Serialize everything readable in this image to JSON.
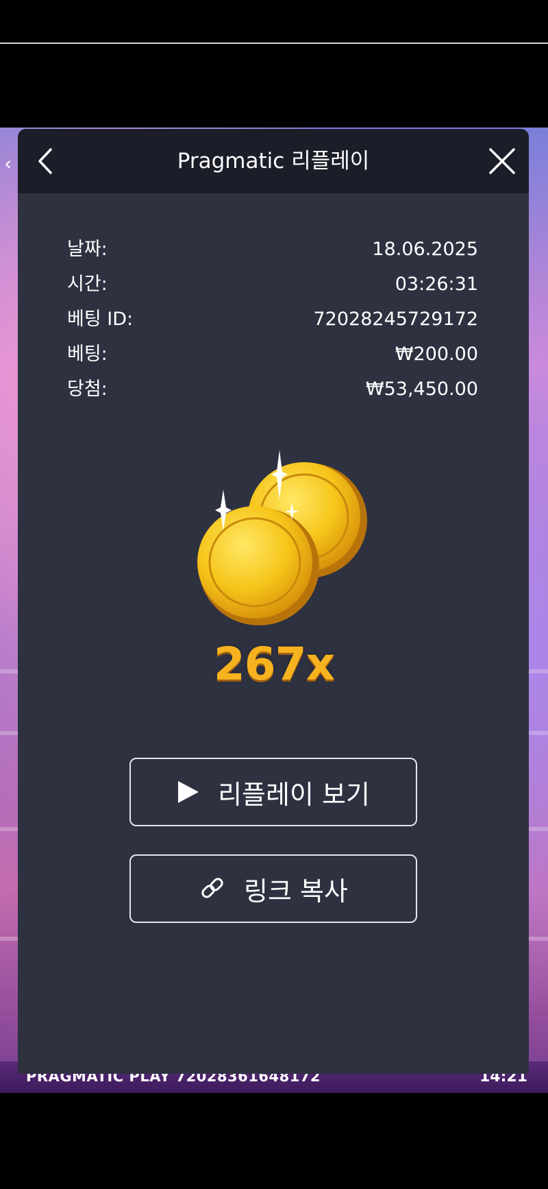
{
  "modal": {
    "title": "Pragmatic 리플레이",
    "back_icon": "chevron-left-icon",
    "close_icon": "close-icon"
  },
  "details": [
    {
      "label": "날짜:",
      "value": "18.06.2025"
    },
    {
      "label": "시간:",
      "value": "03:26:31"
    },
    {
      "label": "베팅 ID:",
      "value": "72028245729172"
    },
    {
      "label": "베팅:",
      "value": "₩200.00"
    },
    {
      "label": "당첨:",
      "value": "₩53,450.00"
    }
  ],
  "win": {
    "multiplier": "267x",
    "image_icon": "gold-coins-icon"
  },
  "buttons": {
    "replay": {
      "label": "리플레이 보기",
      "icon": "play-icon"
    },
    "copy_link": {
      "label": "링크 복사",
      "icon": "link-icon"
    }
  },
  "background": {
    "footer_left": "PRAGMATIC PLAY  72028361648172",
    "footer_right": "14:21"
  },
  "colors": {
    "modal_bg": "#2e3140",
    "header_bg": "#1b1d28",
    "multiplier": "#f7b220"
  }
}
